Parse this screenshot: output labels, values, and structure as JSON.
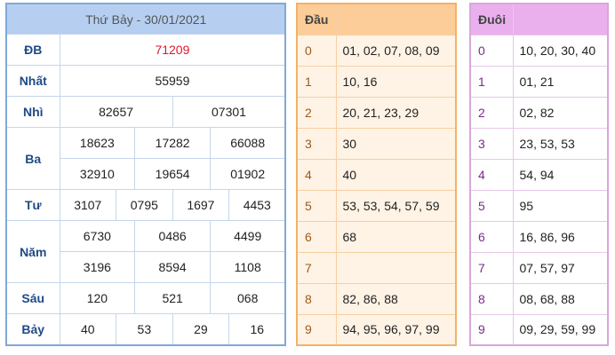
{
  "title": "Thứ Bảy - 30/01/2021",
  "prizes": {
    "db": {
      "label": "ĐB",
      "values": [
        "71209"
      ]
    },
    "nhat": {
      "label": "Nhất",
      "values": [
        "55959"
      ]
    },
    "nhi": {
      "label": "Nhì",
      "values": [
        "82657",
        "07301"
      ]
    },
    "ba": {
      "label": "Ba",
      "values": [
        "18623",
        "17282",
        "66088",
        "32910",
        "19654",
        "01902"
      ]
    },
    "tu": {
      "label": "Tư",
      "values": [
        "3107",
        "0795",
        "1697",
        "4453"
      ]
    },
    "nam": {
      "label": "Năm",
      "values": [
        "6730",
        "0486",
        "4499",
        "3196",
        "8594",
        "1108"
      ]
    },
    "sau": {
      "label": "Sáu",
      "values": [
        "120",
        "521",
        "068"
      ]
    },
    "bay": {
      "label": "Bảy",
      "values": [
        "40",
        "53",
        "29",
        "16"
      ]
    }
  },
  "dau": {
    "header": "Đầu",
    "rows": [
      {
        "digit": "0",
        "values": "01, 02, 07, 08, 09"
      },
      {
        "digit": "1",
        "values": "10, 16"
      },
      {
        "digit": "2",
        "values": "20, 21, 23, 29"
      },
      {
        "digit": "3",
        "values": "30"
      },
      {
        "digit": "4",
        "values": "40"
      },
      {
        "digit": "5",
        "values": "53, 53, 54, 57, 59"
      },
      {
        "digit": "6",
        "values": "68"
      },
      {
        "digit": "7",
        "values": ""
      },
      {
        "digit": "8",
        "values": "82, 86, 88"
      },
      {
        "digit": "9",
        "values": "94, 95, 96, 97, 99"
      }
    ]
  },
  "duoi": {
    "header": "Đuôi",
    "rows": [
      {
        "digit": "0",
        "values": "10, 20, 30, 40"
      },
      {
        "digit": "1",
        "values": "01, 21"
      },
      {
        "digit": "2",
        "values": "02, 82"
      },
      {
        "digit": "3",
        "values": "23, 53, 53"
      },
      {
        "digit": "4",
        "values": "54, 94"
      },
      {
        "digit": "5",
        "values": "95"
      },
      {
        "digit": "6",
        "values": "16, 86, 96"
      },
      {
        "digit": "7",
        "values": "07, 57, 97"
      },
      {
        "digit": "8",
        "values": "08, 68, 88"
      },
      {
        "digit": "9",
        "values": "09, 29, 59, 99"
      }
    ]
  },
  "colors": {
    "db_value": "#e0162d",
    "result_header": "#b6cff1",
    "dau_header": "#fccd99",
    "duoi_header": "#eab0ee"
  }
}
